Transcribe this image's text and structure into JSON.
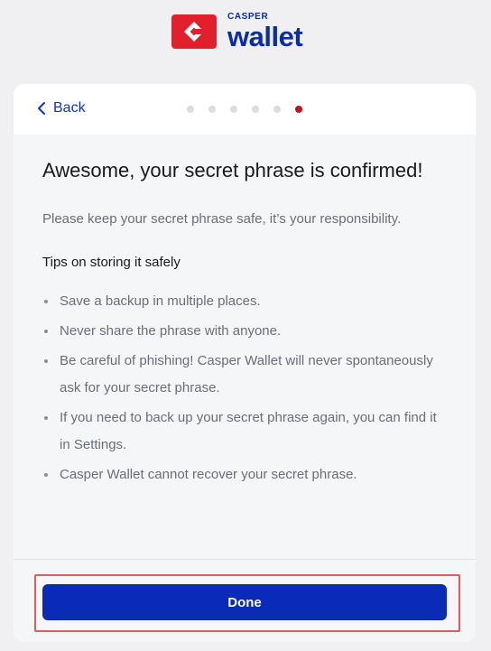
{
  "brand": {
    "small": "CASPER",
    "big": "wallet",
    "color": "#0a2ca8",
    "mark_color": "#e2202d"
  },
  "nav": {
    "back_label": "Back",
    "steps_total": 6,
    "active_step": 6
  },
  "content": {
    "title": "Awesome, your secret phrase is confirmed!",
    "subtitle": "Please keep your secret phrase safe, it’s your responsibility.",
    "tips_heading": "Tips on storing it safely",
    "tips": [
      "Save a backup in multiple places.",
      "Never share the phrase with anyone.",
      "Be careful of phishing! Casper Wallet will never spontaneously ask for your secret phrase.",
      "If you need to back up your secret phrase again, you can find it in Settings.",
      "Casper Wallet cannot recover your secret phrase."
    ]
  },
  "footer": {
    "done_label": "Done",
    "button_color": "#0a2ab8",
    "highlight_color": "#e35a5f"
  }
}
